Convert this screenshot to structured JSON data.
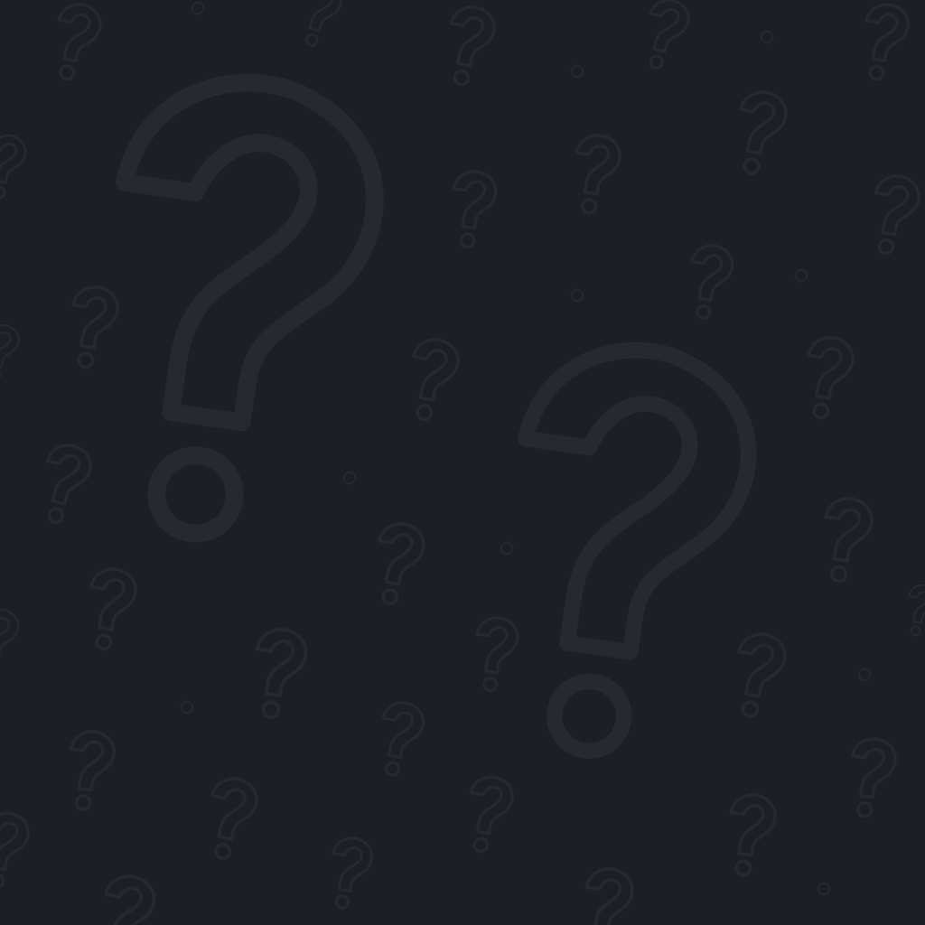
{
  "background": {
    "color": "#1c1f23",
    "outline_color": "#262a2f",
    "pattern": "question-mark-outlines"
  }
}
